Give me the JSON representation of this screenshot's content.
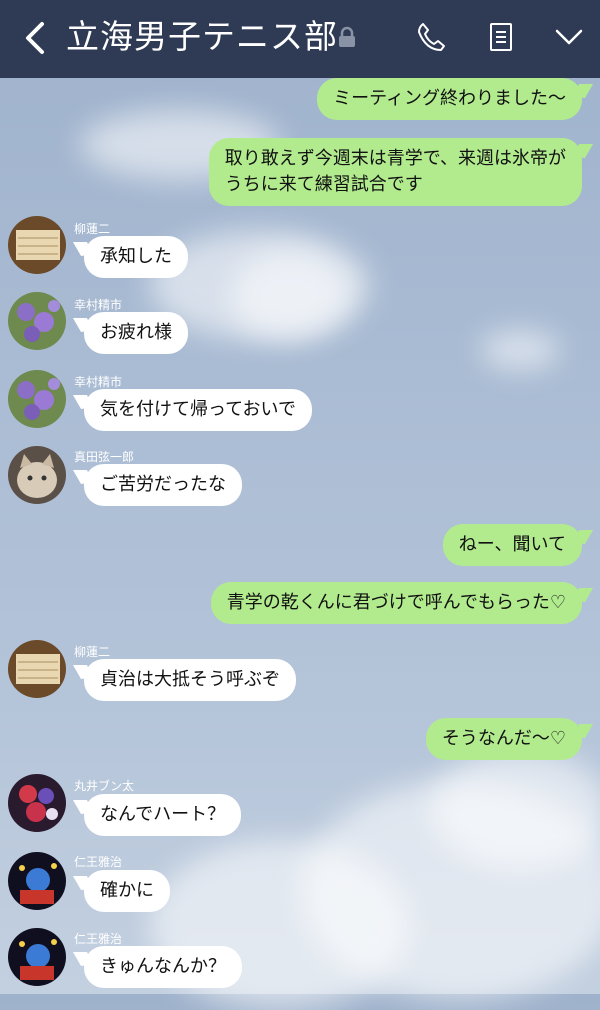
{
  "header": {
    "title": "立海男子テニス部",
    "icons": {
      "back": "chevron-left-icon",
      "lock": "lock-icon",
      "call": "phone-icon",
      "notes": "notes-icon",
      "menu": "chevron-down-icon"
    }
  },
  "colors": {
    "header_bg": "#2f3b55",
    "outgoing_bubble": "#b2eb8e",
    "incoming_bubble": "#ffffff"
  },
  "messages": [
    {
      "direction": "out",
      "text": "ミーティング終わりました〜"
    },
    {
      "direction": "out",
      "lines": [
        "取り敢えず今週末は青学で、来週は氷帝が",
        "うちに来て練習試合です"
      ]
    },
    {
      "direction": "in",
      "sender": "柳蓮二",
      "text": "承知した"
    },
    {
      "direction": "in",
      "sender": "幸村精市",
      "text": "お疲れ様"
    },
    {
      "direction": "in",
      "sender": "幸村精市",
      "text": "気を付けて帰っておいで"
    },
    {
      "direction": "in",
      "sender": "真田弦一郎",
      "text": "ご苦労だったな"
    },
    {
      "direction": "out",
      "text": "ねー、聞いて"
    },
    {
      "direction": "out",
      "text": "青学の乾くんに君づけで呼んでもらった♡"
    },
    {
      "direction": "in",
      "sender": "柳蓮二",
      "text": "貞治は大抵そう呼ぶぞ"
    },
    {
      "direction": "out",
      "text": "そうなんだ〜♡"
    },
    {
      "direction": "in",
      "sender": "丸井ブン太",
      "text": "なんでハート？"
    },
    {
      "direction": "in",
      "sender": "仁王雅治",
      "text": "確かに"
    },
    {
      "direction": "in",
      "sender": "仁王雅治",
      "text": "きゅんなんか？"
    }
  ]
}
